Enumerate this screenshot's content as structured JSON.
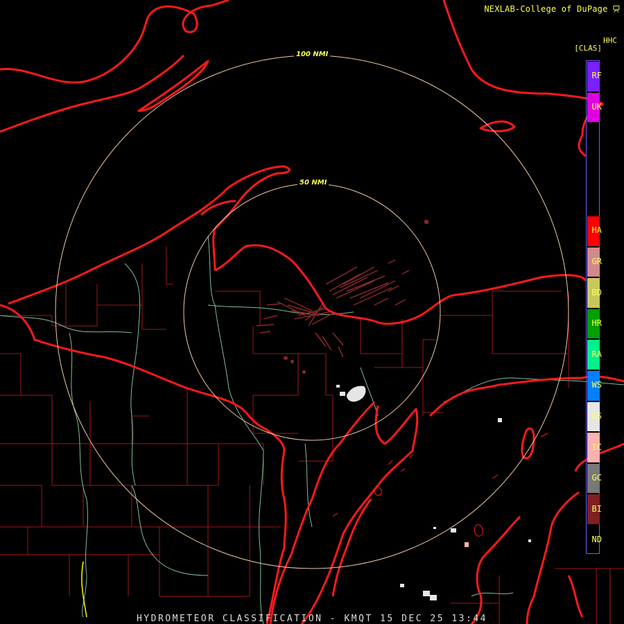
{
  "header": {
    "credit": "NEXLAB-College of DuPage",
    "product_code": "HHC",
    "product_unit": "[CLAS]"
  },
  "footer": {
    "title": "HYDROMETEOR CLASSIFICATION - KMQT 15 DEC 25 13:44"
  },
  "range_rings": [
    {
      "label": "100 NMI"
    },
    {
      "label": "50 NMI"
    }
  ],
  "legend": [
    {
      "code": "RF",
      "color": "#7a1fff"
    },
    {
      "code": "UK",
      "color": "#e000e0"
    },
    {
      "code": "HA",
      "color": "#ff0000"
    },
    {
      "code": "GR",
      "color": "#d08a8a"
    },
    {
      "code": "BD",
      "color": "#c8c85a"
    },
    {
      "code": "HR",
      "color": "#00a000"
    },
    {
      "code": "RA",
      "color": "#00f08c"
    },
    {
      "code": "WS",
      "color": "#0080ff"
    },
    {
      "code": "DS",
      "color": "#e6e6e6"
    },
    {
      "code": "IC",
      "color": "#ffb0b0"
    },
    {
      "code": "GC",
      "color": "#787878"
    },
    {
      "code": "BI",
      "color": "#802020"
    },
    {
      "code": "ND",
      "color": "#000000"
    }
  ],
  "colors": {
    "state_border": "#ff1a1a",
    "county_line": "#a01818",
    "river": "#7fbf9a",
    "ring": "#f0c8a0"
  }
}
